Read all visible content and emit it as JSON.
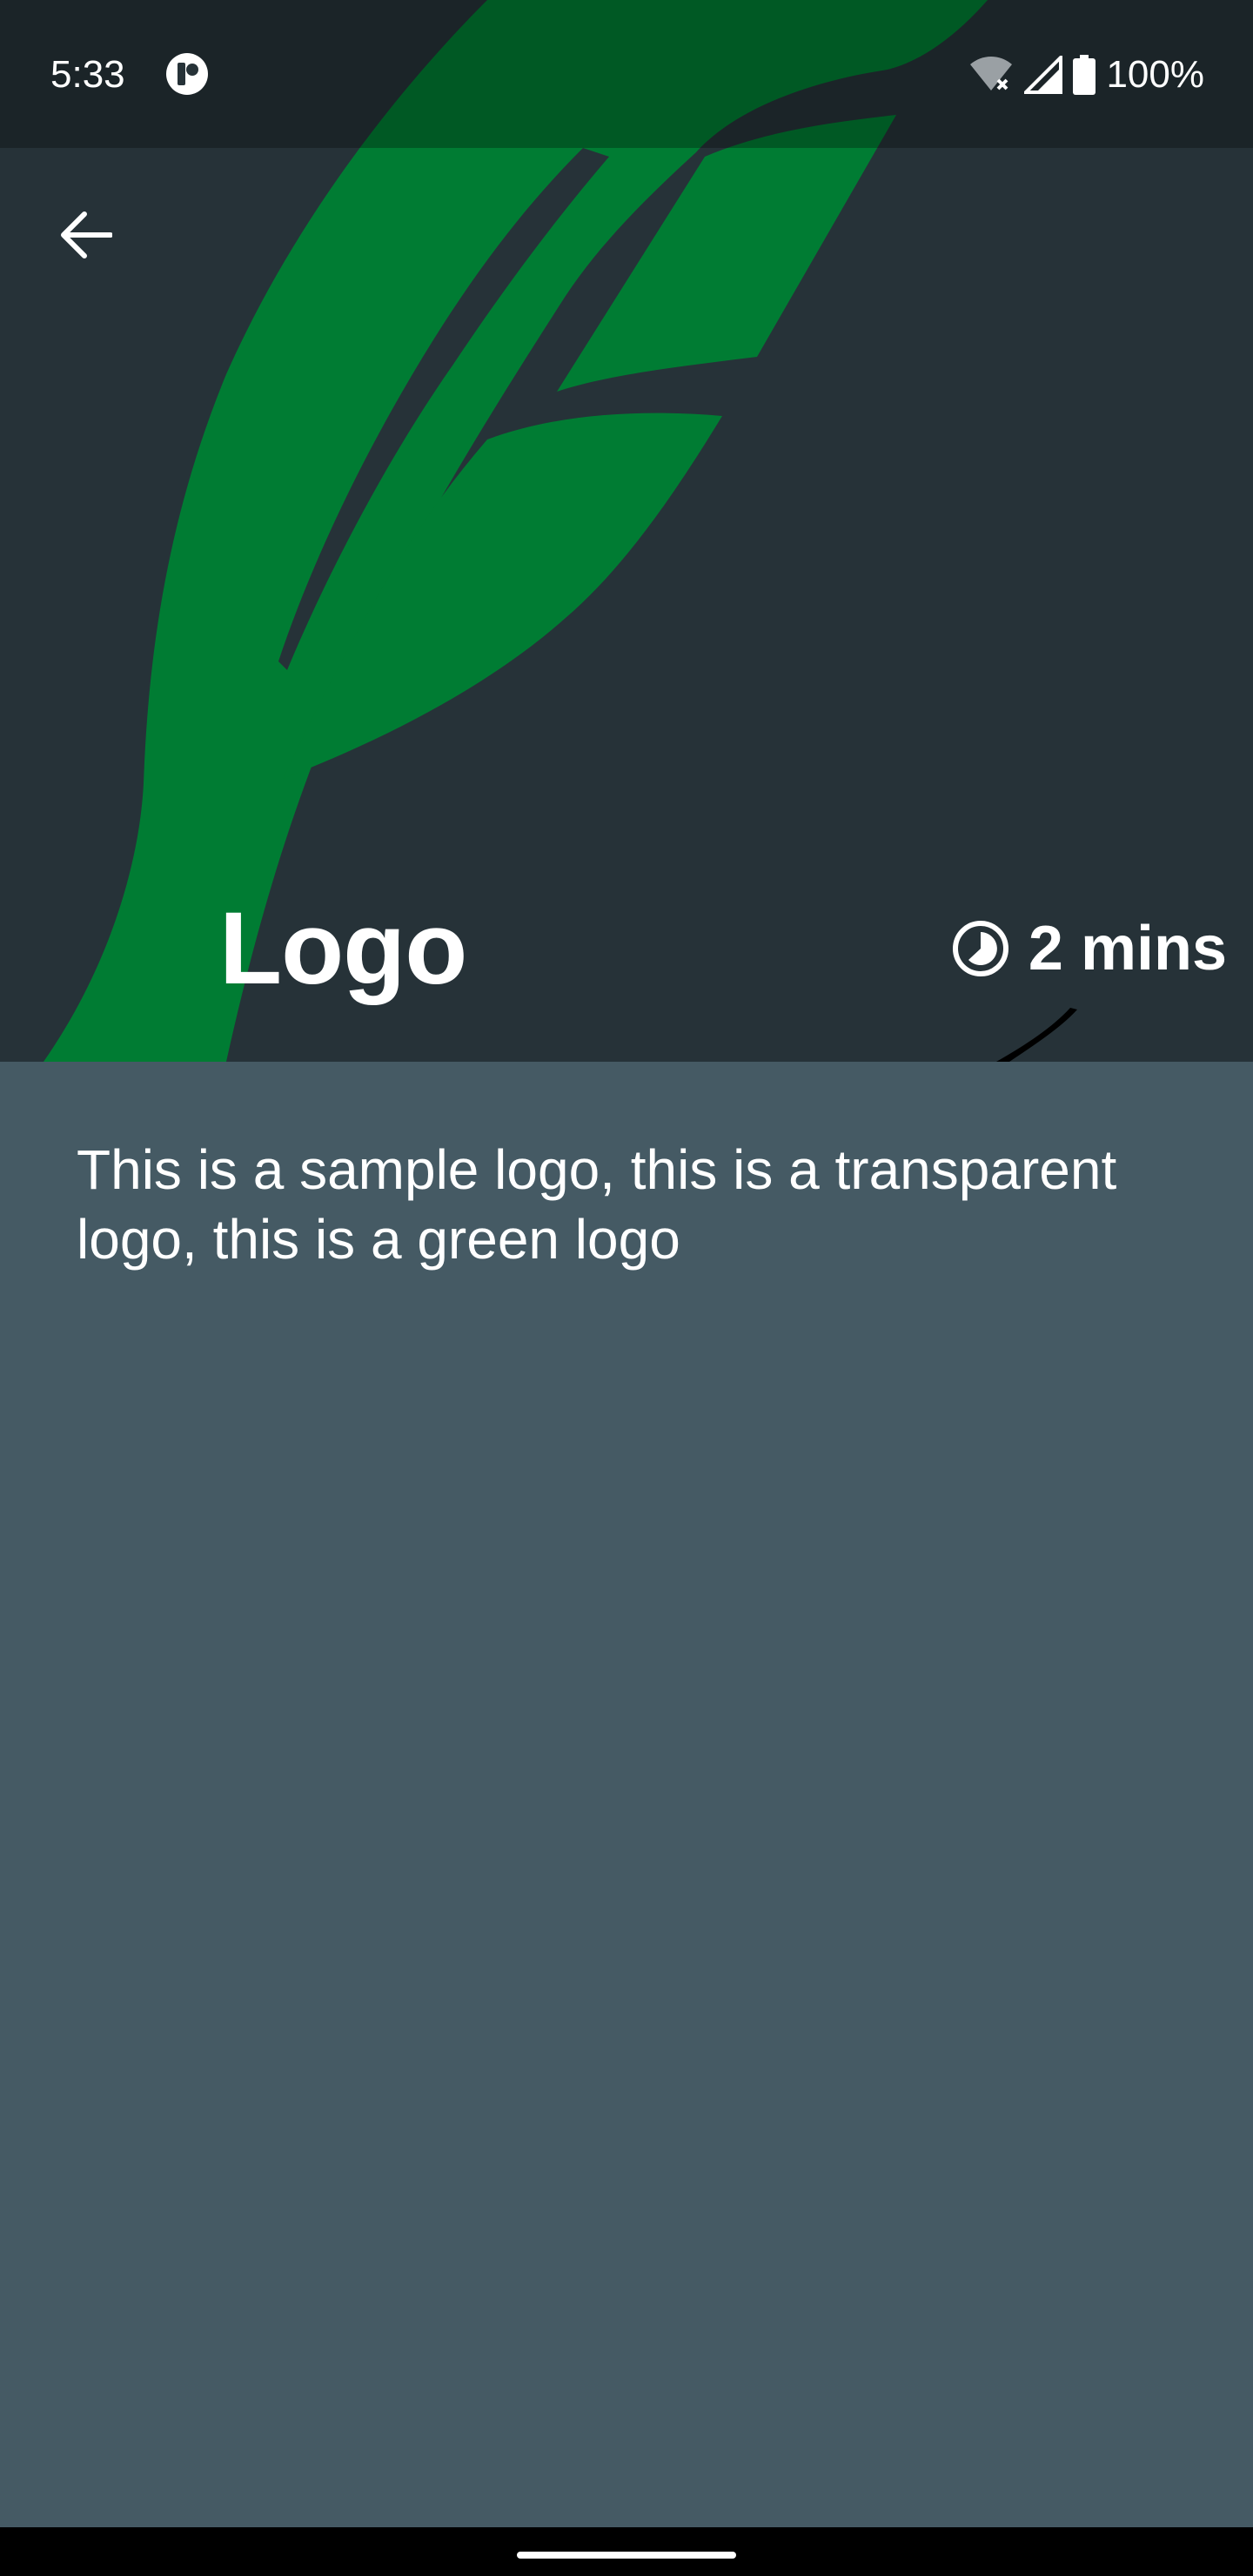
{
  "status_bar": {
    "time": "5:33",
    "battery": "100%",
    "icons": [
      "app-notification-icon",
      "wifi-off-icon",
      "cell-signal-icon",
      "battery-full-icon"
    ]
  },
  "toolbar": {
    "back_icon": "arrow-left-icon"
  },
  "hero": {
    "image": "green-feather-logo",
    "title": "Logo",
    "duration_icon": "timer-icon",
    "duration": "2 mins"
  },
  "content": {
    "description": "This is a sample logo, this is a transparent logo, this is a green logo"
  },
  "colors": {
    "hero_background": "#263238",
    "content_background": "#455a64",
    "logo_green": "#007c33",
    "text": "#ffffff"
  }
}
